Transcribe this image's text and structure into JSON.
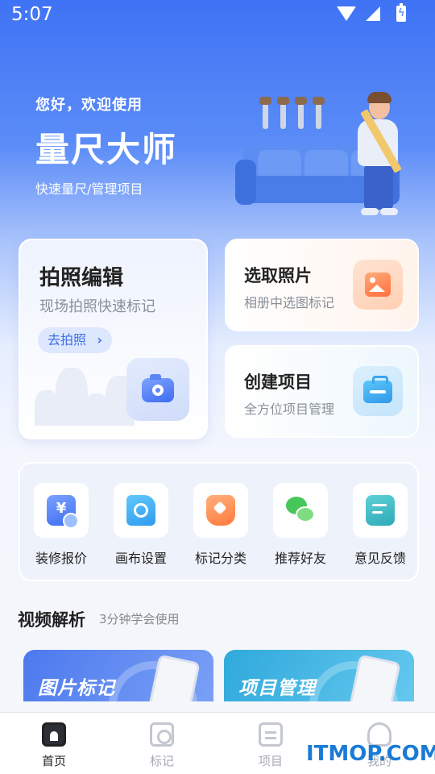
{
  "status_bar": {
    "time": "5:07"
  },
  "header": {
    "greeting": "您好，欢迎使用",
    "title": "量尺大师",
    "subtitle": "快速量尺/管理项目"
  },
  "cards": {
    "photo_edit": {
      "title": "拍照编辑",
      "subtitle": "现场拍照快速标记",
      "button": "去拍照",
      "chevron": "›"
    },
    "pick_photo": {
      "title": "选取照片",
      "subtitle": "相册中选图标记"
    },
    "create_project": {
      "title": "创建项目",
      "subtitle": "全方位项目管理"
    }
  },
  "quick_actions": [
    {
      "label": "装修报价",
      "icon": "quote-icon",
      "glyph": "¥"
    },
    {
      "label": "画布设置",
      "icon": "canvas-settings-icon"
    },
    {
      "label": "标记分类",
      "icon": "tag-icon"
    },
    {
      "label": "推荐好友",
      "icon": "wechat-icon"
    },
    {
      "label": "意见反馈",
      "icon": "feedback-icon"
    }
  ],
  "video_section": {
    "title": "视频解析",
    "subtitle": "3分钟学会使用",
    "cards": [
      {
        "label": "图片标记"
      },
      {
        "label": "项目管理"
      }
    ]
  },
  "tab_bar": [
    {
      "label": "首页",
      "active": true
    },
    {
      "label": "标记",
      "active": false
    },
    {
      "label": "项目",
      "active": false
    },
    {
      "label": "我的",
      "active": false
    }
  ],
  "watermark": "ITMOP.COM",
  "colors": {
    "primary": "#3f73f5",
    "orange": "#ff7a3c",
    "blue_accent": "#2f9bee"
  }
}
